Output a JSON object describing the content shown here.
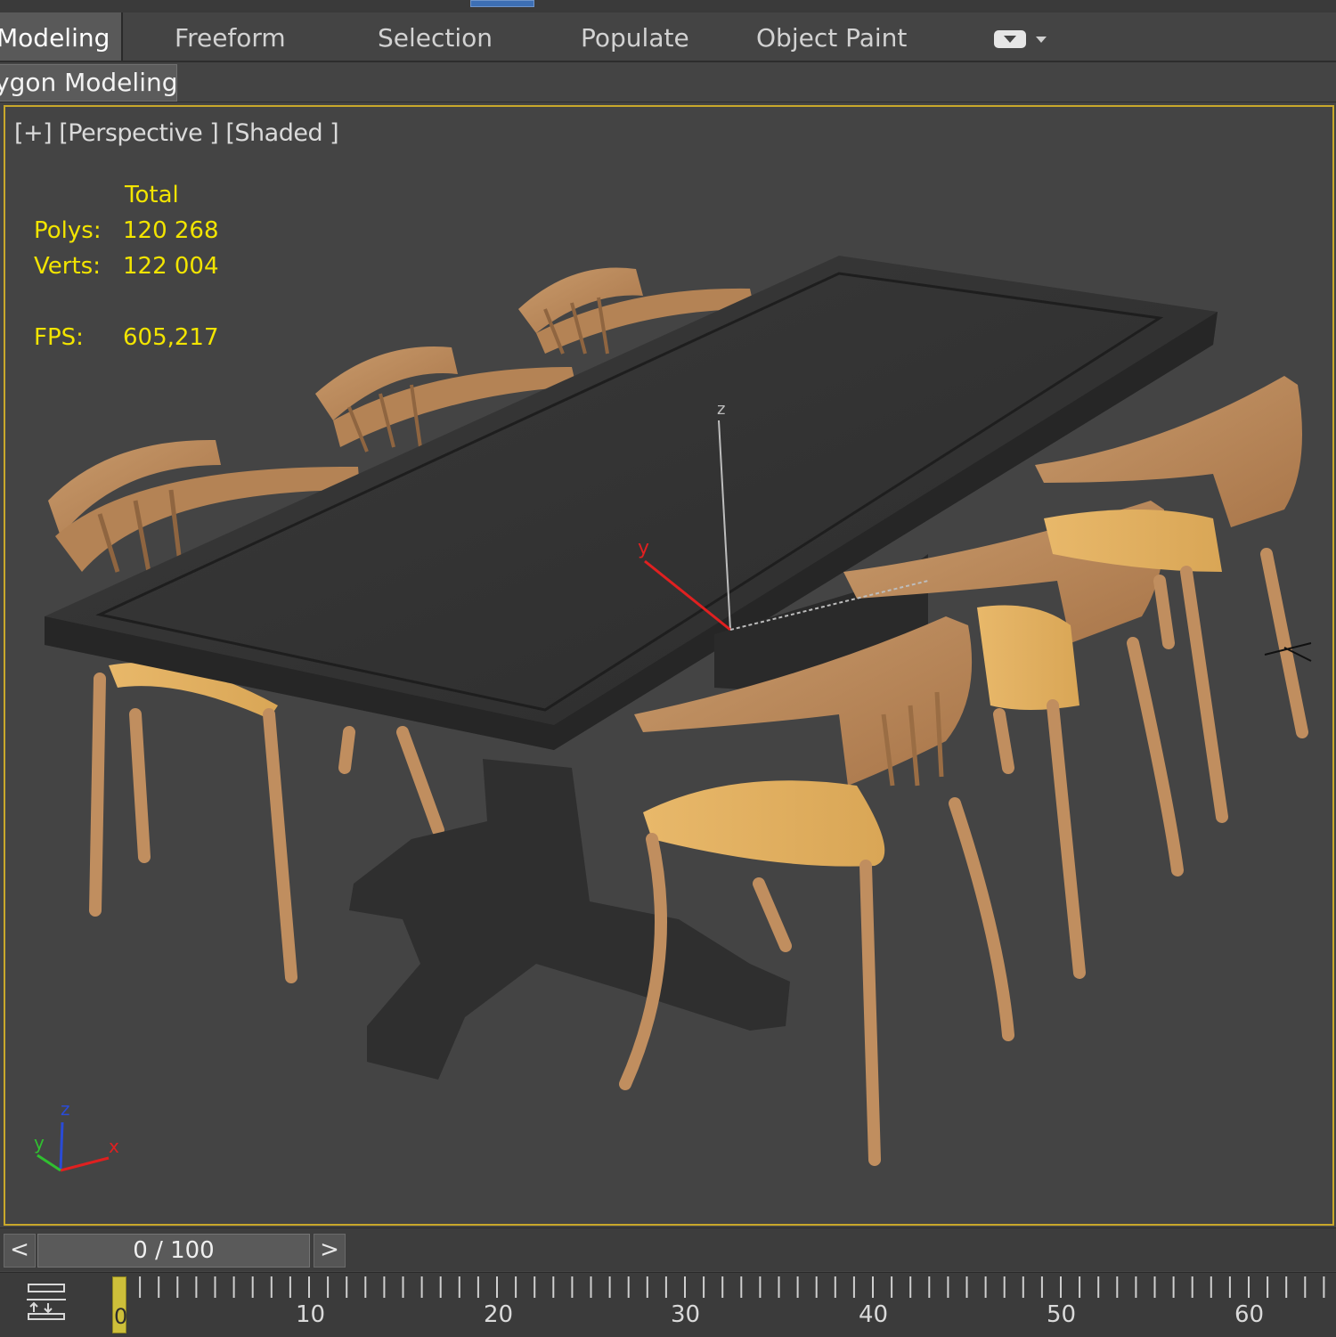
{
  "ribbon": {
    "tabs": [
      {
        "label": "Modeling",
        "active": true
      },
      {
        "label": "Freeform"
      },
      {
        "label": "Selection"
      },
      {
        "label": "Populate"
      },
      {
        "label": "Object Paint"
      }
    ],
    "extra_icon": "speech-bubble-icon"
  },
  "sub_ribbon": {
    "label": "Polygon Modeling",
    "visible_label": "ygon Modeling"
  },
  "viewport": {
    "label": "[+] [Perspective ] [Shaded ]",
    "border_color": "#c9a82b",
    "stats": {
      "header": "Total",
      "polys_label": "Polys:",
      "polys_value": "120 268",
      "verts_label": "Verts:",
      "verts_value": "122 004",
      "fps_label": "FPS:",
      "fps_value": "605,217",
      "color": "#f2e400"
    },
    "gizmo": {
      "axes": [
        "z",
        "y"
      ]
    },
    "corner_axes": {
      "x": "x",
      "y": "y",
      "z": "z"
    }
  },
  "time_slider": {
    "prev": "<",
    "next": ">",
    "value": "0 / 100"
  },
  "trackbar": {
    "current_frame": "0",
    "labels": [
      "10",
      "20",
      "30",
      "40",
      "50",
      "60"
    ]
  }
}
